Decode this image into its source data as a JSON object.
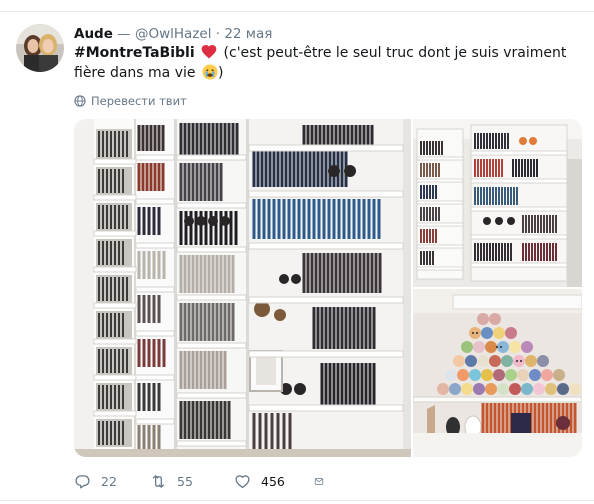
{
  "tweet": {
    "author": {
      "name": "Aude",
      "handle_line": " — @OwlHazel · 22 мая"
    },
    "text": {
      "hashtag": "#MontreTaBibli",
      "body": " (c'est peut-être le seul truc dont je suis vraiment fière dans ma vie ",
      "close": ")"
    },
    "translate_label": "Перевести твит",
    "actions": {
      "replies": "22",
      "retweets": "55",
      "likes": "456"
    },
    "colors": {
      "accent": "#1da1f2",
      "heart": "#e0245e",
      "meta_text": "#657786",
      "divider": "#e6ecf0"
    },
    "icons": [
      "heart-emoji-icon",
      "crying-face-emoji-icon",
      "globe-icon",
      "reply-icon",
      "retweet-icon",
      "like-icon",
      "direct-message-icon"
    ]
  }
}
